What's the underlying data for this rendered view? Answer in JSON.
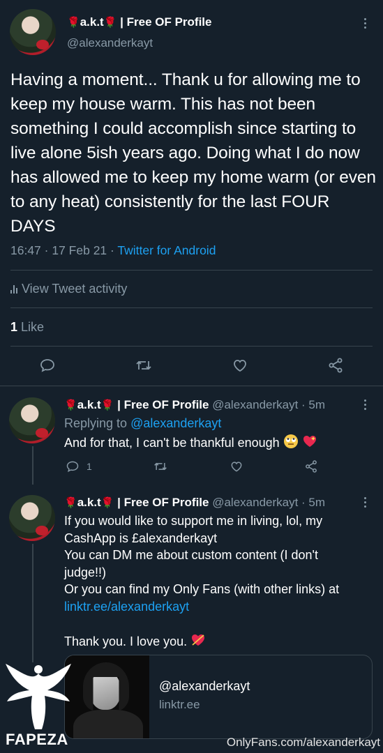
{
  "main_tweet": {
    "name": "a.k.t",
    "name_suffix": "| Free OF Profile",
    "handle": "@alexanderkayt",
    "text": "Having a moment... Thank u for allowing me to keep my house warm. This has not been something I could accomplish since starting to live alone 5ish years ago. Doing what I do now has allowed me to keep my home warm (or even to any heat) consistently for the last FOUR DAYS",
    "time": "16:47 · 17 Feb 21 · ",
    "source": "Twitter for Android",
    "activity_label": "View Tweet activity",
    "likes_count": "1",
    "likes_label": " Like"
  },
  "reply1": {
    "name": "a.k.t",
    "name_suffix": "| Free OF Profile",
    "handle": "@alexanderkayt",
    "age": " · 5m",
    "replying_prefix": "Replying to ",
    "replying_handle": "@alexanderkayt",
    "text": "And for that, I can't be thankful enough",
    "reply_count": "1"
  },
  "reply2": {
    "name": "a.k.t",
    "name_suffix": "| Free OF Profile",
    "handle": "@alexanderkayt",
    "age": " · 5m",
    "line1": "If you would like to support me in living, lol, my",
    "line2": "CashApp is £alexanderkayt",
    "line3": "You can DM me about custom content (I don't",
    "line4": "judge!!)",
    "line5": "Or you can find my Only Fans (with other links) at",
    "link": "linktr.ee/alexanderkayt",
    "thanks": "Thank you. I love you.",
    "card_title": "@alexanderkayt",
    "card_domain": "linktr.ee"
  },
  "watermark": {
    "left": "FAPEZA",
    "right": "OnlyFans.com/alexanderkayt"
  },
  "icons": [
    "rose-emoji",
    "more-icon",
    "bar-chart-icon",
    "reply-icon",
    "retweet-icon",
    "like-icon",
    "share-icon",
    "rolling-eyes-emoji",
    "sparkling-heart-emoji",
    "heart-arrow-emoji"
  ],
  "colors": {
    "background": "#15202b",
    "link": "#1da1f2",
    "muted": "#8899a6",
    "divider": "#38444d"
  }
}
